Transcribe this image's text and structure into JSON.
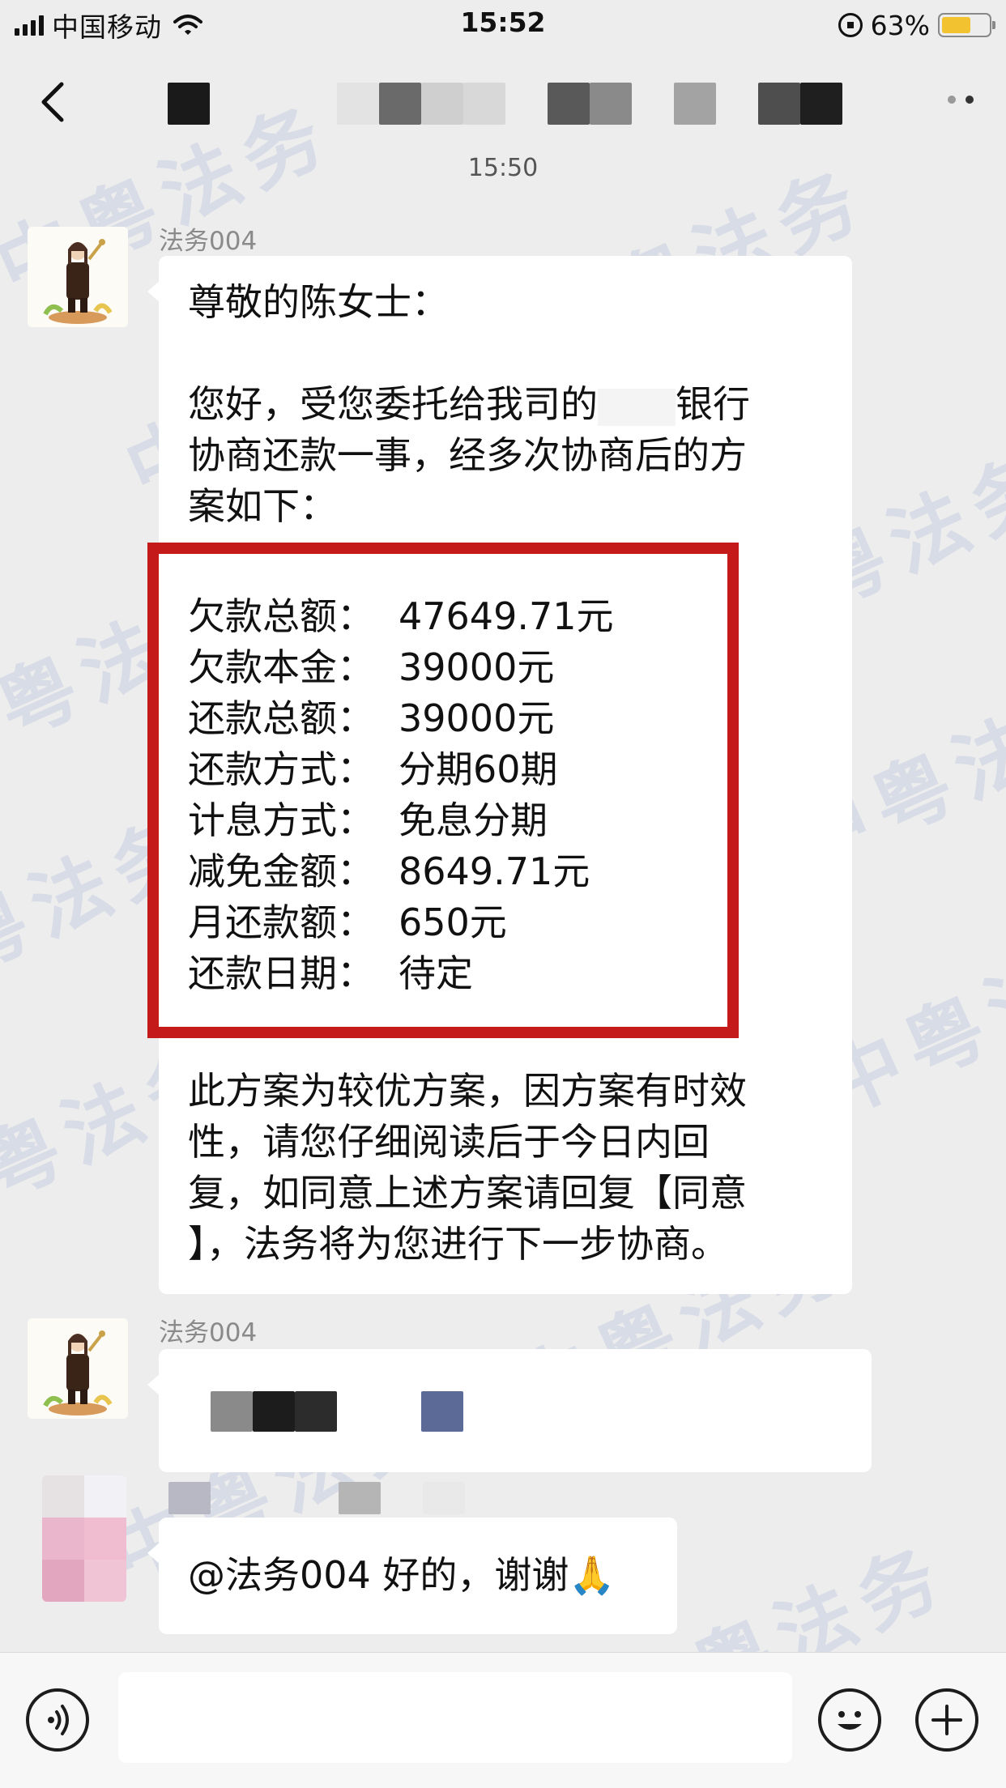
{
  "status_bar": {
    "carrier": "中国移动",
    "time": "15:52",
    "battery_percent": "63%",
    "battery_level": 0.63,
    "battery_color": "#f2c230"
  },
  "nav": {
    "back_icon": "chevron-left-icon",
    "more_icon": "more-dots-icon"
  },
  "chat": {
    "time_label": "15:50",
    "messages": [
      {
        "sender": "法务004",
        "greeting": "尊敬的陈女士：",
        "intro_line1": "您好，受您委托给我司的",
        "intro_line1_bank": "银行",
        "intro_line2": "协商还款一事，经多次协商后的方",
        "intro_line3": "案如下：",
        "plan": [
          {
            "label": "欠款总额：",
            "value": "47649.71元"
          },
          {
            "label": "欠款本金：",
            "value": "39000元"
          },
          {
            "label": "还款总额：",
            "value": "39000元"
          },
          {
            "label": "还款方式：",
            "value": "分期60期"
          },
          {
            "label": "计息方式：",
            "value": "免息分期"
          },
          {
            "label": "减免金额：",
            "value": "8649.71元"
          },
          {
            "label": "月还款额：",
            "value": "650元"
          },
          {
            "label": "还款日期：",
            "value": "待定"
          }
        ],
        "outro": [
          "此方案为较优方案，因方案有时效",
          "性，请您仔细阅读后于今日内回",
          "复，如同意上述方案请回复【同意",
          "】，法务将为您进行下一步协商。"
        ]
      },
      {
        "sender": "法务004"
      },
      {
        "reply": "@法务004 好的，谢谢🙏"
      }
    ],
    "watermark_text": "中粤法务",
    "highlight_color": "#c41a1a"
  },
  "input_bar": {
    "voice_icon": "voice-icon",
    "emoji_icon": "emoji-icon",
    "plus_icon": "plus-icon"
  }
}
